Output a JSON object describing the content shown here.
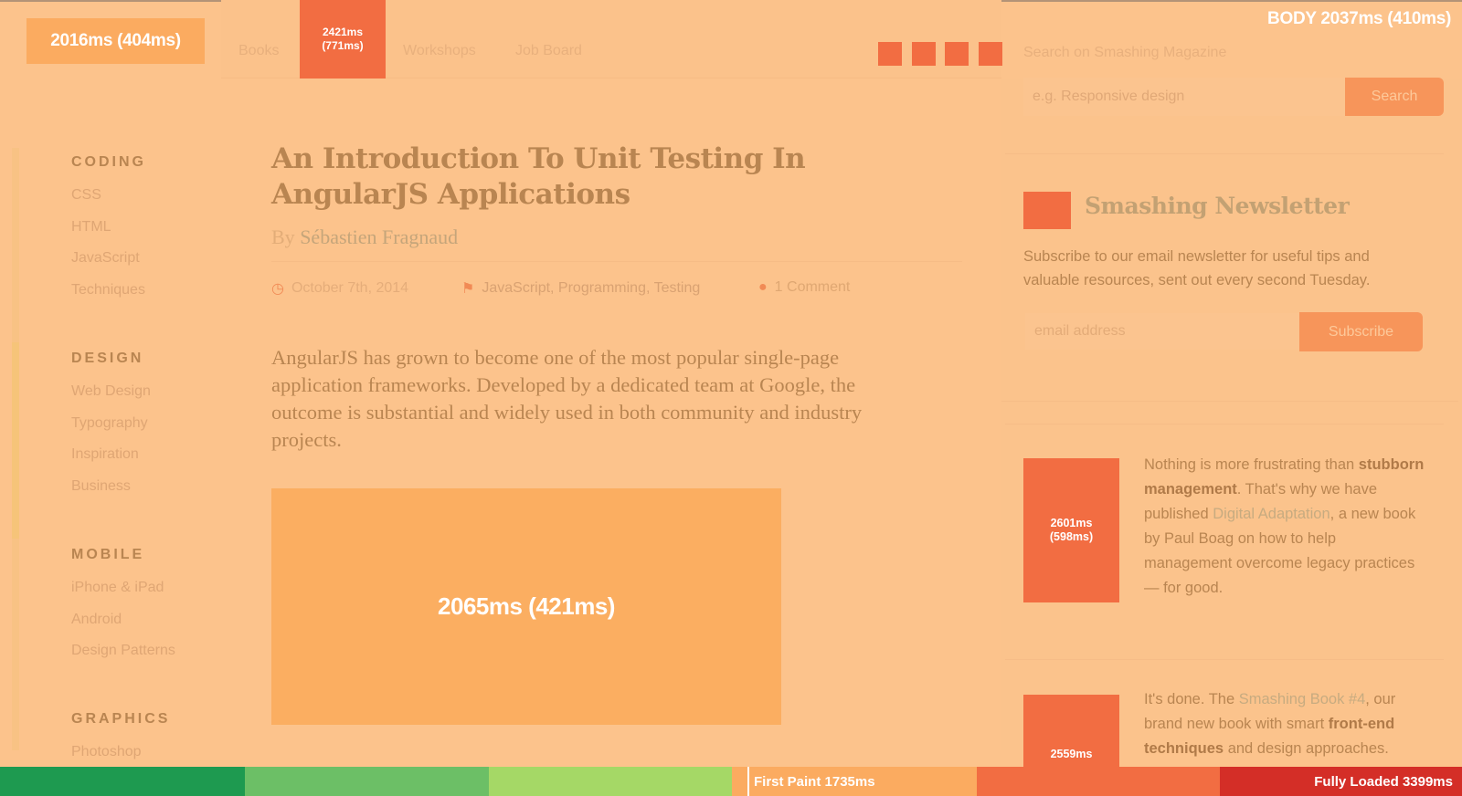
{
  "header": {
    "logo_timing": "2016ms (404ms)",
    "nav_items": [
      "Books",
      "Workshops",
      "Job Board"
    ],
    "nav_overlay_timing": [
      "2421ms",
      "(771ms)"
    ],
    "body_timing": "BODY 2037ms (410ms)",
    "social_icons": [
      "social-icon-1",
      "social-icon-2",
      "social-icon-3",
      "social-icon-4"
    ]
  },
  "search": {
    "label": "Search on Smashing Magazine",
    "placeholder": "e.g. Responsive design",
    "button": "Search"
  },
  "sidebar": {
    "categories": [
      {
        "heading": "CODING",
        "links": [
          "CSS",
          "HTML",
          "JavaScript",
          "Techniques"
        ]
      },
      {
        "heading": "DESIGN",
        "links": [
          "Web Design",
          "Typography",
          "Inspiration",
          "Business"
        ]
      },
      {
        "heading": "MOBILE",
        "links": [
          "iPhone & iPad",
          "Android",
          "Design Patterns"
        ]
      },
      {
        "heading": "GRAPHICS",
        "links": [
          "Photoshop"
        ]
      }
    ]
  },
  "article": {
    "title": "An Introduction To Unit Testing In AngularJS Applications",
    "byline_prefix": "By",
    "author": "Sébastien Fragnaud",
    "date": "October 7th, 2014",
    "categories": "JavaScript, Programming, Testing",
    "comments": "1 Comment",
    "excerpt": "AngularJS has grown to become one of the most popular single-page application frameworks. Developed by a dedicated team at Google, the outcome is substantial and widely used in both community and industry projects.",
    "hero_timing": "2065ms (421ms)"
  },
  "newsletter": {
    "title": "Smashing Newsletter",
    "description": "Subscribe to our email newsletter for useful tips and valuable resources, sent out every second Tuesday.",
    "placeholder": "email address",
    "button": "Subscribe"
  },
  "promos": [
    {
      "timing": [
        "2601ms",
        "(598ms)"
      ],
      "text_1": "Nothing is more frustrating than ",
      "bold_1": "stubborn management",
      "text_2": ". That's why we have published ",
      "link": "Digital Adaptation",
      "text_3": ", a new book by Paul Boag on how to help management overcome legacy practices — for good."
    },
    {
      "timing": [
        "2559ms"
      ],
      "text_1": "It's done. The ",
      "link": "Smashing Book #4",
      "text_2": ", our brand new book with smart ",
      "bold_1": "front-end techniques",
      "text_3": " and design approaches."
    }
  ],
  "timeline": {
    "first_paint_label": "First Paint 1735ms",
    "fully_loaded_label": "Fully Loaded 3399ms",
    "segments": [
      {
        "color": "#1e9a50"
      },
      {
        "color": "#6cbf66"
      },
      {
        "color": "#a5d866"
      },
      {
        "color": "#fbab60"
      },
      {
        "color": "#f26d42"
      },
      {
        "color": "#d42e27"
      }
    ]
  },
  "colors": {
    "overlay_orange": "#f26d42",
    "overlay_light": "#fbab60",
    "page_tint": "#fcc38c"
  }
}
